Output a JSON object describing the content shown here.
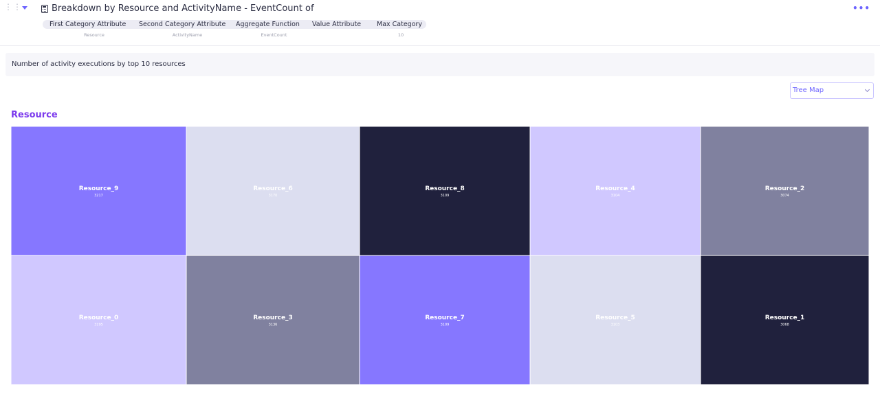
{
  "header": {
    "title": "Breakdown by Resource and ActivityName - EventCount of",
    "more_label": "•••",
    "params": [
      {
        "label": "First Category Attribute",
        "value": "Resource"
      },
      {
        "label": "Second Category Attribute",
        "value": "ActivityName"
      },
      {
        "label": "Aggregate Function",
        "value": "EventCount"
      },
      {
        "label": "Value Attribute",
        "value": ""
      },
      {
        "label": "Max Category",
        "value": "10"
      }
    ]
  },
  "description": "Number of activity executions by top 10 resources",
  "chart_type_select": {
    "selected": "Tree Map"
  },
  "chart_data": {
    "type": "heatmap",
    "title": "Resource",
    "cells": [
      {
        "name": "Resource_9",
        "value": 3217,
        "color": "#8677ff"
      },
      {
        "name": "Resource_6",
        "value": 3170,
        "color": "#dcdef0"
      },
      {
        "name": "Resource_8",
        "value": 3109,
        "color": "#20213d"
      },
      {
        "name": "Resource_4",
        "value": 3104,
        "color": "#d0c8ff"
      },
      {
        "name": "Resource_2",
        "value": 3074,
        "color": "#80819f"
      },
      {
        "name": "Resource_0",
        "value": 3195,
        "color": "#d0c8ff"
      },
      {
        "name": "Resource_3",
        "value": 3136,
        "color": "#80819f"
      },
      {
        "name": "Resource_7",
        "value": 3109,
        "color": "#8677ff"
      },
      {
        "name": "Resource_5",
        "value": 3103,
        "color": "#dcdef0"
      },
      {
        "name": "Resource_1",
        "value": 3068,
        "color": "#20213d"
      }
    ]
  }
}
